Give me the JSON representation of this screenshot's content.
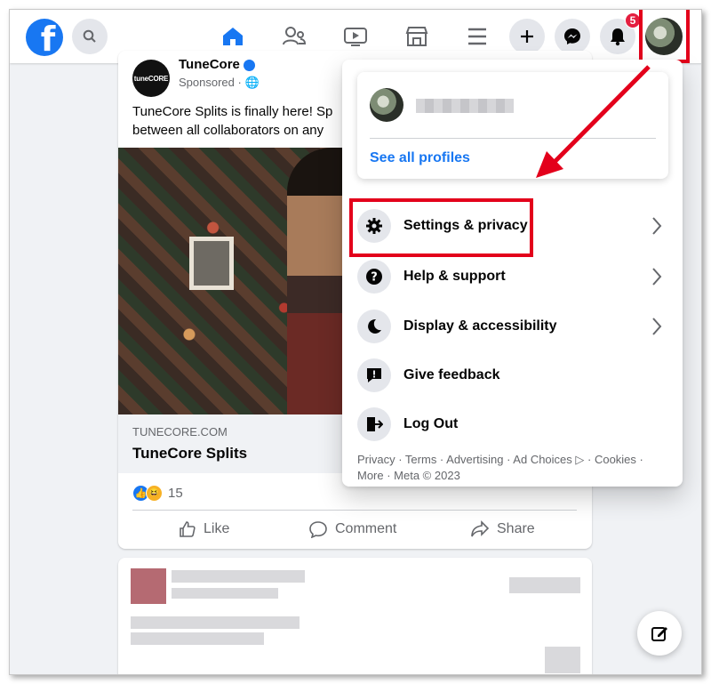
{
  "nav": {
    "logo_letter": "f",
    "notifications_badge": "5"
  },
  "post": {
    "avatar_text": "tuneCORE",
    "page_name": "TuneCore",
    "sponsored": "Sponsored ·",
    "text": "TuneCore Splits is finally here! Sp\nbetween all collaborators on any",
    "link_domain": "TUNECORE.COM",
    "link_title": "TuneCore Splits",
    "reaction_count": "15",
    "actions": {
      "like": "Like",
      "comment": "Comment",
      "share": "Share"
    }
  },
  "menu": {
    "see_all_profiles": "See all profiles",
    "items": [
      {
        "label": "Settings & privacy",
        "icon": "gear-icon",
        "chevron": true
      },
      {
        "label": "Help & support",
        "icon": "question-icon",
        "chevron": true
      },
      {
        "label": "Display & accessibility",
        "icon": "moon-icon",
        "chevron": true
      },
      {
        "label": "Give feedback",
        "icon": "feedback-icon",
        "chevron": false
      },
      {
        "label": "Log Out",
        "icon": "logout-icon",
        "chevron": false
      }
    ],
    "footer": "Privacy · Terms · Advertising · Ad Choices ▷ · Cookies · More · Meta © 2023"
  },
  "colors": {
    "brand": "#1877f2",
    "highlight": "#e3001b",
    "badge": "#e41e3f"
  }
}
